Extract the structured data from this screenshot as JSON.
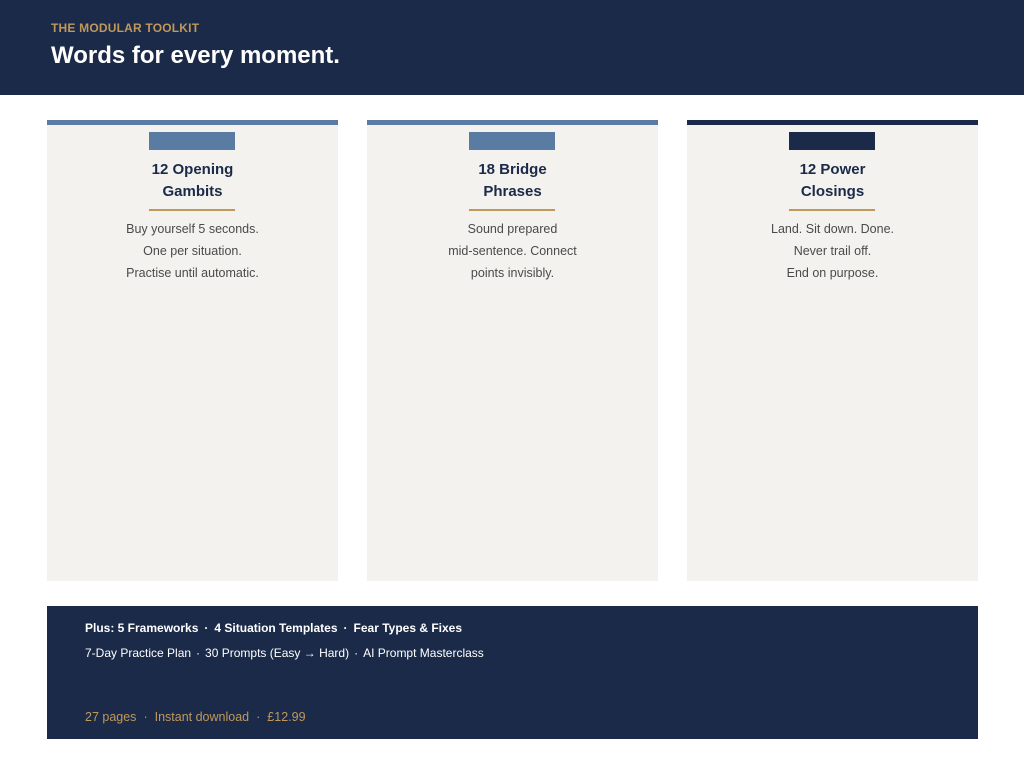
{
  "header": {
    "eyebrow": "THE MODULAR TOOLKIT",
    "headline": "Words for every moment."
  },
  "cards": [
    {
      "title_lines": [
        "12 Opening",
        "Gambits"
      ],
      "body_lines": [
        "Buy yourself 5 seconds.",
        "One per situation.",
        "Practise until automatic."
      ],
      "accent": "#5a7ca3"
    },
    {
      "title_lines": [
        "18 Bridge",
        "Phrases"
      ],
      "body_lines": [
        "Sound prepared",
        "mid-sentence. Connect",
        "points invisibly."
      ],
      "accent": "#5a7ca3"
    },
    {
      "title_lines": [
        "12 Power",
        "Closings"
      ],
      "body_lines": [
        "Land. Sit down. Done.",
        "Never trail off.",
        "End on purpose."
      ],
      "accent": "#1b2a48"
    }
  ],
  "footer": {
    "extras_primary": [
      "Plus: 5 Frameworks",
      "4 Situation Templates",
      "Fear Types & Fixes"
    ],
    "extras_secondary": [
      "7-Day Practice Plan",
      "30 Prompts (Easy → Hard)",
      "AI Prompt Masterclass"
    ],
    "separator": "·",
    "meta": [
      "27 pages",
      "Instant download",
      "£12.99"
    ]
  },
  "colors": {
    "navy": "#1b2a48",
    "steel_blue": "#5a7ca3",
    "gold": "#c0985b",
    "card_bg": "#f3f2ef"
  }
}
